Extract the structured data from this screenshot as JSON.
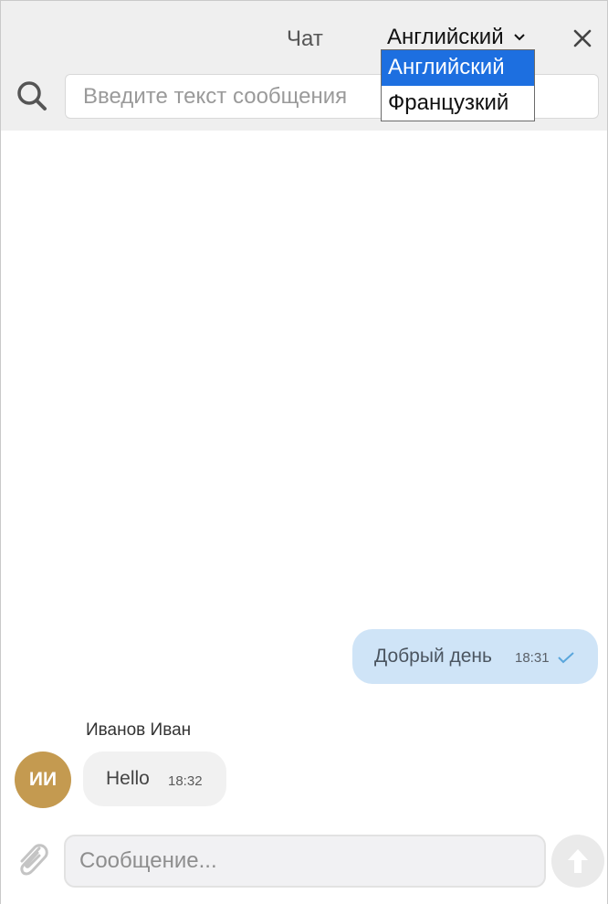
{
  "header": {
    "title": "Чат",
    "language": {
      "selected": "Английский",
      "options": [
        "Английский",
        "Французкий"
      ],
      "selected_index": 0
    },
    "close_icon": "close-icon"
  },
  "search": {
    "placeholder": "Введите текст сообщения",
    "value": "",
    "icon": "search-icon"
  },
  "messages": [
    {
      "direction": "outgoing",
      "text": "Добрый день",
      "time": "18:31",
      "status_icon": "check-icon"
    },
    {
      "direction": "incoming",
      "sender": "Иванов Иван",
      "avatar_initials": "ИИ",
      "text": "Hello",
      "time": "18:32"
    }
  ],
  "composer": {
    "placeholder": "Сообщение...",
    "value": "",
    "attach_icon": "paperclip-icon",
    "send_icon": "arrow-up-icon"
  },
  "colors": {
    "header_bg": "#efefef",
    "dropdown_selected": "#1d6fe0",
    "outgoing_bubble": "#cfe4f7",
    "incoming_bubble": "#f1f1f1",
    "avatar_bg": "#c49a50",
    "check": "#5aa6dc"
  }
}
